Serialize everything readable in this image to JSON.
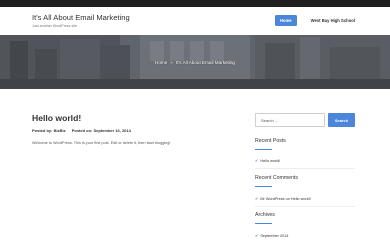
{
  "site": {
    "title": "It's All About Email Marketing",
    "tagline": "Just another WordPress site"
  },
  "nav": {
    "items": [
      {
        "label": "Home",
        "active": true
      },
      {
        "label": "West Bay High School",
        "active": false
      }
    ]
  },
  "hero": {
    "breadcrumb": {
      "home": "Home",
      "separator": "»",
      "current": "It's All About Email Marketing"
    }
  },
  "post": {
    "title": "Hello world!",
    "meta_posted_by_label": "Posted by:",
    "meta_author": "BizBiz",
    "meta_posted_on_label": "Posted on:",
    "meta_date": "September 16, 2014",
    "body": "Welcome to WordPress. This is your first post. Edit or delete it, then start blogging!"
  },
  "sidebar": {
    "search": {
      "placeholder": "Search ...",
      "button_label": "Search"
    },
    "recent_posts": {
      "title": "Recent Posts",
      "items": [
        "Hello world!"
      ]
    },
    "recent_comments": {
      "title": "Recent Comments",
      "items": [
        "Mr WordPress on Hello world!"
      ]
    },
    "archives": {
      "title": "Archives",
      "items": [
        "September 2014"
      ]
    }
  },
  "colors": {
    "accent": "#4a86d9",
    "topbar": "#1f1f1f",
    "text": "#333333"
  },
  "icons": {
    "list_bullet": "check-icon"
  }
}
